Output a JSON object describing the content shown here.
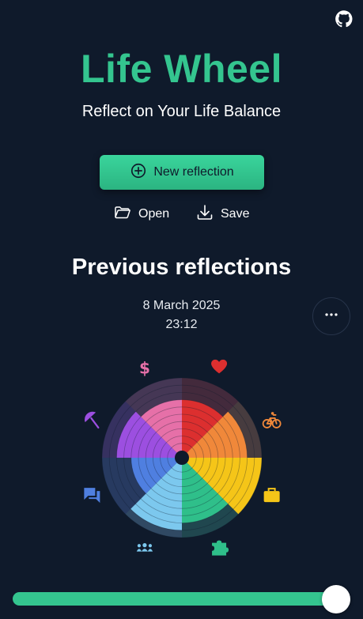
{
  "header": {
    "title": "Life Wheel",
    "subtitle": "Reflect on Your Life Balance",
    "github_icon": "github-icon"
  },
  "actions": {
    "new_label": "New reflection",
    "open_label": "Open",
    "save_label": "Save"
  },
  "reflections": {
    "section_title": "Previous reflections",
    "date": "8 March 2025",
    "time": "23:12",
    "more_icon": "more-horizontal-icon"
  },
  "wheel": {
    "max": 10,
    "categories": [
      {
        "icon": "heart-icon",
        "color": "#dc2f2f",
        "value": 7
      },
      {
        "icon": "bicycle-icon",
        "color": "#f0883a",
        "value": 8
      },
      {
        "icon": "briefcase-icon",
        "color": "#f5c518",
        "value": 10
      },
      {
        "icon": "puzzle-icon",
        "color": "#2fbf8a",
        "value": 8
      },
      {
        "icon": "people-icon",
        "color": "#7cc8ee",
        "value": 9
      },
      {
        "icon": "chat-icon",
        "color": "#4f7fe0",
        "value": 6
      },
      {
        "icon": "umbrella-icon",
        "color": "#9c4fe0",
        "value": 8
      },
      {
        "icon": "dollar-icon",
        "color": "#e670a8",
        "value": 7
      }
    ]
  },
  "slider": {
    "value": 1.0
  },
  "colors": {
    "background": "#0f1a2b",
    "accent": "#34c58f"
  }
}
